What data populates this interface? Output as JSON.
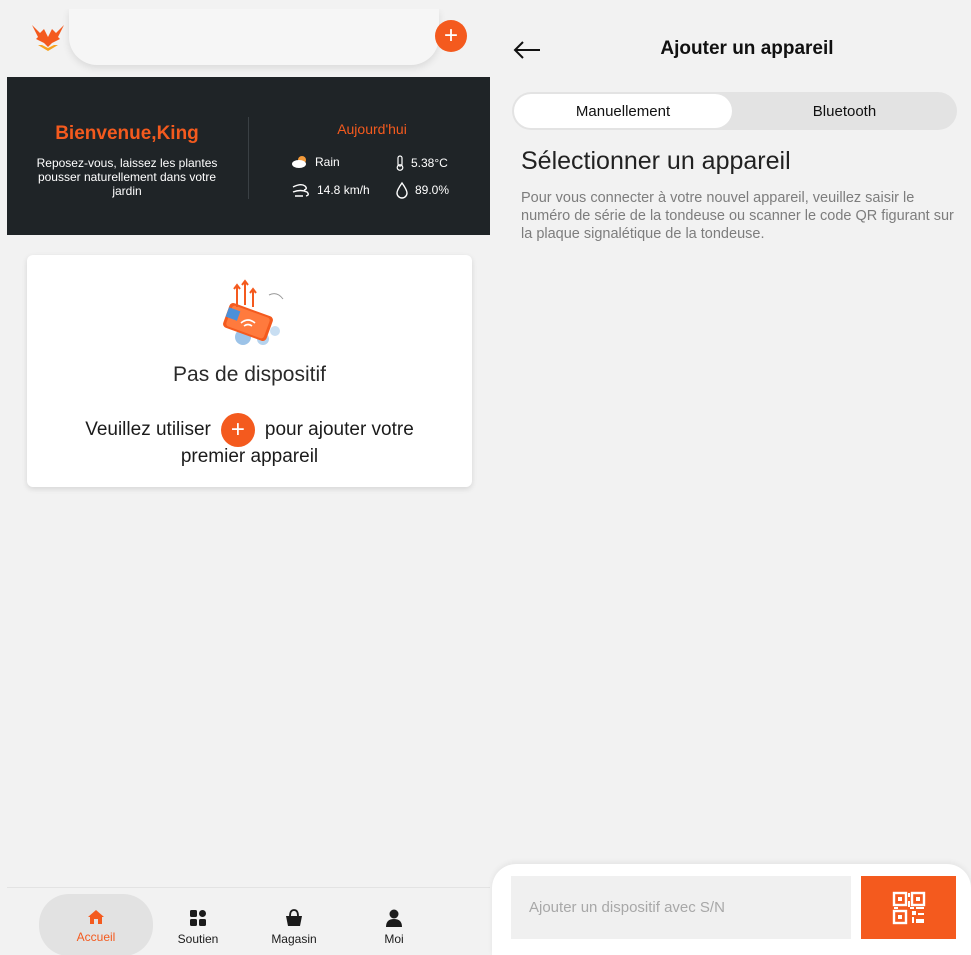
{
  "left": {
    "banner": {
      "welcome": "Bienvenue,King",
      "welcome_sub": "Reposez-vous, laissez les plantes pousser naturellement dans votre jardin",
      "today": "Aujourd'hui",
      "weather": "Rain",
      "temperature": "5.38°C",
      "wind": "14.8 km/h",
      "humidity": "89.0%"
    },
    "card": {
      "no_device": "Pas de dispositif",
      "use_prefix": "Veuillez utiliser",
      "use_suffix": "pour ajouter votre",
      "first_line": "premier appareil"
    },
    "tabs": [
      {
        "label": "Accueil",
        "icon": "home-icon",
        "active": true
      },
      {
        "label": "Soutien",
        "icon": "apps-icon",
        "active": false
      },
      {
        "label": "Magasin",
        "icon": "basket-icon",
        "active": false
      },
      {
        "label": "Moi",
        "icon": "user-icon",
        "active": false
      }
    ],
    "add_glyph": "+"
  },
  "right": {
    "title": "Ajouter un appareil",
    "segments": {
      "manual": "Manuellement",
      "bluetooth": "Bluetooth"
    },
    "section_title": "Sélectionner un appareil",
    "description": "Pour vous connecter à votre nouvel appareil, veuillez saisir le numéro de série de la tondeuse ou scanner le code QR figurant sur la plaque signalétique de la tondeuse.",
    "sn_placeholder": "Ajouter un dispositif avec S/N"
  },
  "colors": {
    "accent": "#f45a1e",
    "banner_bg": "#1f2427",
    "page_bg": "#f2f2f2"
  }
}
